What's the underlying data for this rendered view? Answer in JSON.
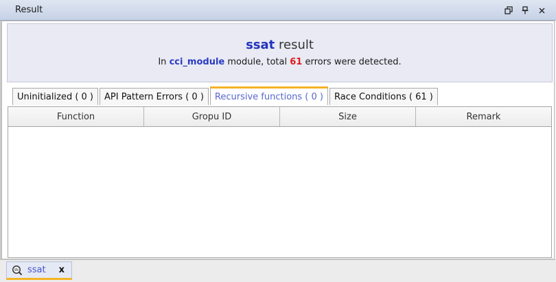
{
  "window": {
    "title": "Result",
    "controls": [
      "restore-icon",
      "pin-icon",
      "close-icon"
    ]
  },
  "header": {
    "tool_name": "ssat",
    "title_suffix": " result",
    "summary_prefix": "In ",
    "module_name": "cci_module",
    "summary_middle": " module, total ",
    "error_count": "61",
    "summary_suffix": " errors were detected."
  },
  "tabs": [
    {
      "label": "Uninitialized ( 0 )",
      "active": false
    },
    {
      "label": "API Pattern Errors ( 0 )",
      "active": false
    },
    {
      "label": "Recursive functions ( 0 )",
      "active": true
    },
    {
      "label": "Race Conditions ( 61 )",
      "active": false
    }
  ],
  "table": {
    "columns": [
      "Function",
      "Gropu ID",
      "Size",
      "Remark"
    ],
    "rows": []
  },
  "bottom_tab": {
    "icon": "search-icon",
    "label": "ssat",
    "close": "x"
  },
  "colors": {
    "accent_blue": "#2233bb",
    "error_red": "#e01b1b",
    "active_tab_text": "#5566cc",
    "active_tab_indicator": "#f5b324"
  }
}
